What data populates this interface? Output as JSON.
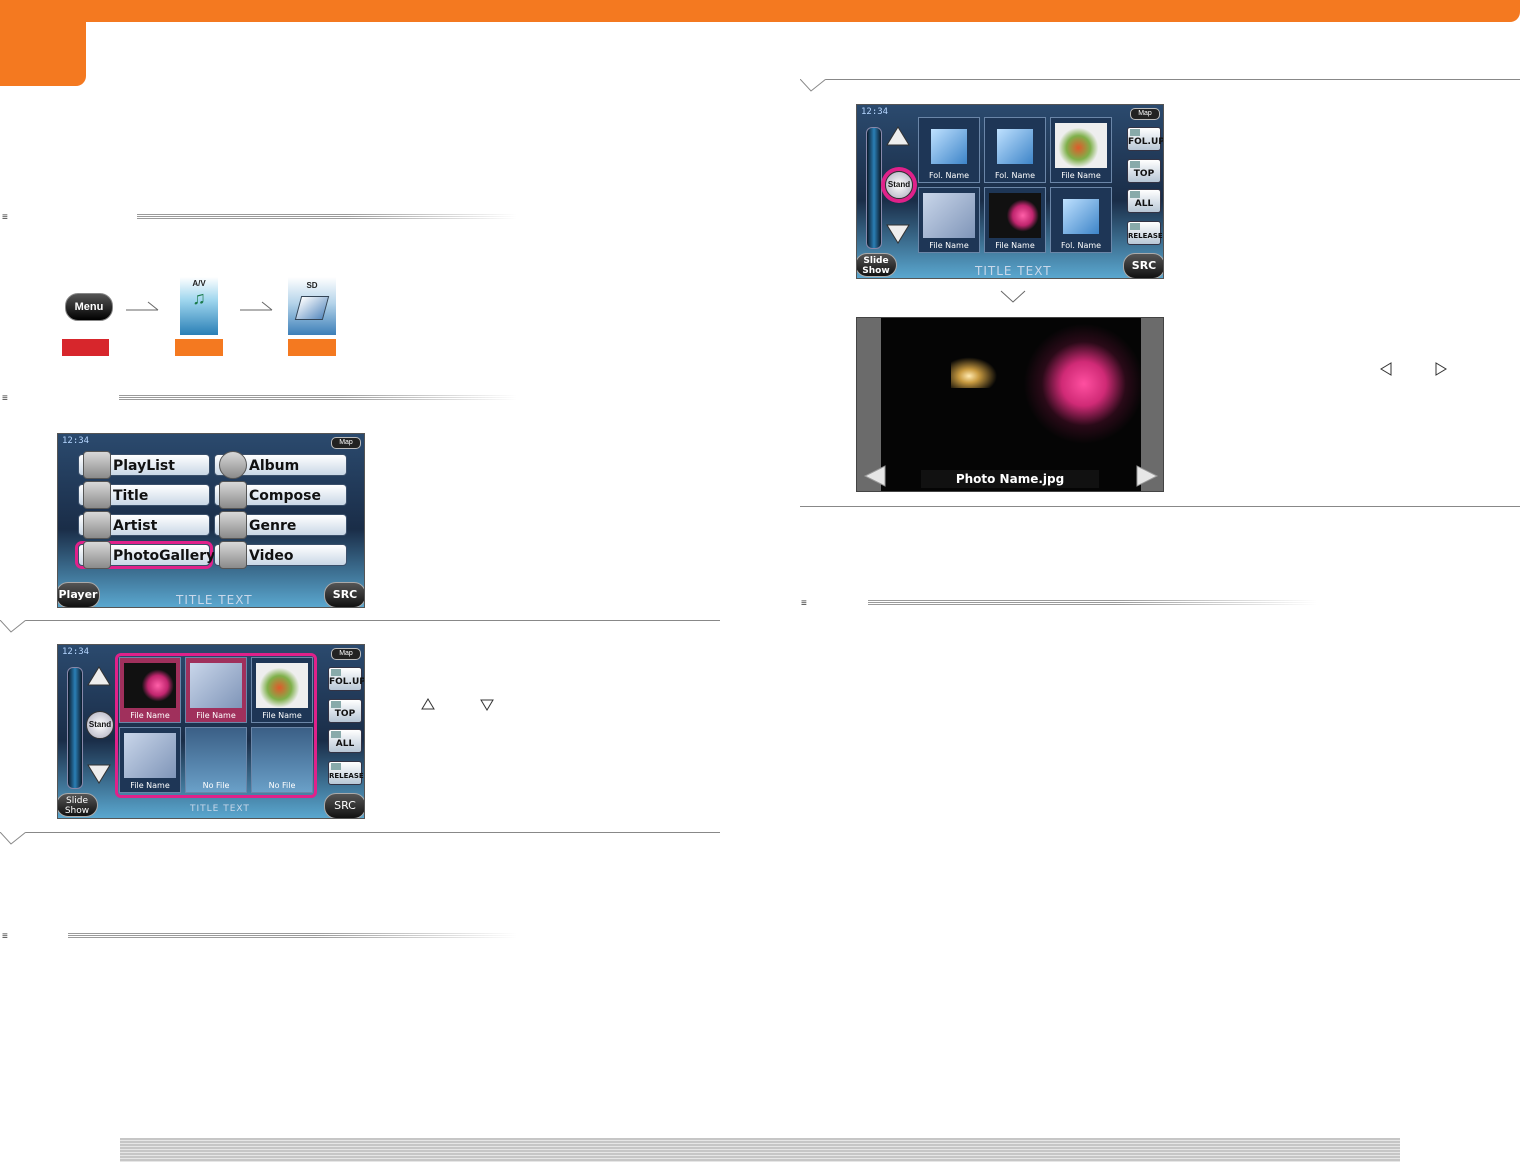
{
  "path_step1": {
    "button_label": "Menu"
  },
  "path_step2": {
    "label": "A/V"
  },
  "path_step3": {
    "label": "SD"
  },
  "menu_screen": {
    "time": "12:34",
    "map_label": "Map",
    "items": [
      "PlayList",
      "Album",
      "Title",
      "Compose",
      "Artist",
      "Genre",
      "PhotoGallery",
      "Video"
    ],
    "left_button": "Player",
    "title_text": "TITLE TEXT",
    "right_button": "SRC"
  },
  "gallery_screen": {
    "time": "12:34",
    "map_label": "Map",
    "stand_label": "Stand",
    "thumbnails": [
      "File Name",
      "File Name",
      "File Name",
      "File Name",
      "No File",
      "No File"
    ],
    "side_buttons": [
      "FOL.UP",
      "TOP",
      "ALL",
      "RELEASE"
    ],
    "left_button": [
      "Slide",
      "Show"
    ],
    "title_text": "TITLE TEXT",
    "right_button": "SRC"
  },
  "folder_screen": {
    "time": "12:34",
    "map_label": "Map",
    "stand_label": "Stand",
    "thumbnails": [
      "Fol. Name",
      "Fol. Name",
      "File Name",
      "File Name",
      "File Name",
      "Fol. Name"
    ],
    "side_buttons": [
      "FOL.UP",
      "TOP",
      "ALL",
      "RELEASE"
    ],
    "left_button": [
      "Slide",
      "Show"
    ],
    "title_text": "TITLE TEXT",
    "right_button": "SRC"
  },
  "photo_view": {
    "caption": "Photo Name.jpg"
  },
  "colors": {
    "accent": "#f47920",
    "label_red": "#d7262c",
    "highlight": "#e0218a"
  }
}
